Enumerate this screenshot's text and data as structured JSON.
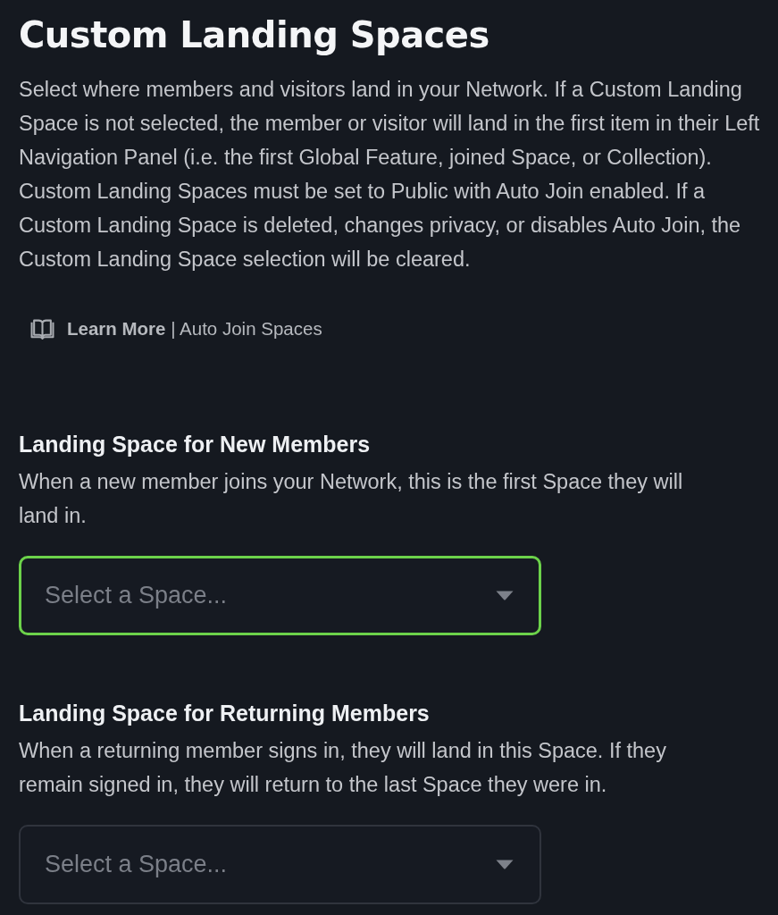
{
  "title": "Custom Landing Spaces",
  "description": "Select where members and visitors land in your Network. If a Custom Landing Space is not selected, the member or visitor will land in the first item in their Left Navigation Panel (i.e. the first Global Feature, joined Space, or Collection). Custom Landing Spaces must be set to Public with Auto Join enabled. If a Custom Landing Space is deleted, changes privacy, or disables Auto Join, the Custom Landing Space selection will be cleared.",
  "learn_more_link": "**Learn More** | Auto Join Spaces",
  "sections": [
    {
      "heading": "Landing Space for New Members",
      "description": "When a new member joins your Network, this is the first Space they will land in.",
      "select": {
        "placeholder": "Select a Space...",
        "focused": true
      }
    },
    {
      "heading": "Landing Space for Returning Members",
      "description": "When a returning member signs in, they will land in this Space. If they remain signed in, they will return to the last Space they were in.",
      "select": {
        "placeholder": "Select a Space...",
        "focused": false
      }
    }
  ]
}
